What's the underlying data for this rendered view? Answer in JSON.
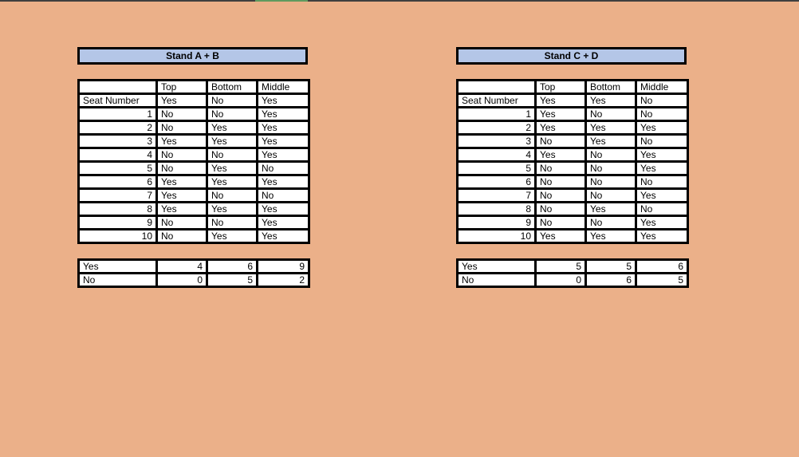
{
  "stands": [
    {
      "title": "Stand A + B",
      "headers": [
        "",
        "Top",
        "Bottom",
        "Middle"
      ],
      "seat_label": "Seat Number",
      "seat_values": [
        "Yes",
        "No",
        "Yes"
      ],
      "rows": [
        {
          "seat": "1",
          "top": "No",
          "bottom": "No",
          "middle": "Yes"
        },
        {
          "seat": "2",
          "top": "No",
          "bottom": "Yes",
          "middle": "Yes"
        },
        {
          "seat": "3",
          "top": "Yes",
          "bottom": "Yes",
          "middle": "Yes"
        },
        {
          "seat": "4",
          "top": "No",
          "bottom": "No",
          "middle": "Yes"
        },
        {
          "seat": "5",
          "top": "No",
          "bottom": "Yes",
          "middle": "No"
        },
        {
          "seat": "6",
          "top": "Yes",
          "bottom": "Yes",
          "middle": "Yes"
        },
        {
          "seat": "7",
          "top": "Yes",
          "bottom": "No",
          "middle": "No"
        },
        {
          "seat": "8",
          "top": "Yes",
          "bottom": "Yes",
          "middle": "Yes"
        },
        {
          "seat": "9",
          "top": "No",
          "bottom": "No",
          "middle": "Yes"
        },
        {
          "seat": "10",
          "top": "No",
          "bottom": "Yes",
          "middle": "Yes"
        }
      ],
      "summary": [
        {
          "label": "Yes",
          "top": "4",
          "bottom": "6",
          "middle": "9"
        },
        {
          "label": "No",
          "top": "0",
          "bottom": "5",
          "middle": "2"
        }
      ]
    },
    {
      "title": "Stand C + D",
      "headers": [
        "",
        "Top",
        "Bottom",
        "Middle"
      ],
      "seat_label": "Seat Number",
      "seat_values": [
        "Yes",
        "Yes",
        "No"
      ],
      "rows": [
        {
          "seat": "1",
          "top": "Yes",
          "bottom": "No",
          "middle": "No"
        },
        {
          "seat": "2",
          "top": "Yes",
          "bottom": "Yes",
          "middle": "Yes"
        },
        {
          "seat": "3",
          "top": "No",
          "bottom": "Yes",
          "middle": "No"
        },
        {
          "seat": "4",
          "top": "Yes",
          "bottom": "No",
          "middle": "Yes"
        },
        {
          "seat": "5",
          "top": "No",
          "bottom": "No",
          "middle": "Yes"
        },
        {
          "seat": "6",
          "top": "No",
          "bottom": "No",
          "middle": "No"
        },
        {
          "seat": "7",
          "top": "No",
          "bottom": "No",
          "middle": "Yes"
        },
        {
          "seat": "8",
          "top": "No",
          "bottom": "Yes",
          "middle": "No"
        },
        {
          "seat": "9",
          "top": "No",
          "bottom": "No",
          "middle": "Yes"
        },
        {
          "seat": "10",
          "top": "Yes",
          "bottom": "Yes",
          "middle": "Yes"
        }
      ],
      "summary": [
        {
          "label": "Yes",
          "top": "5",
          "bottom": "5",
          "middle": "6"
        },
        {
          "label": "No",
          "top": "0",
          "bottom": "6",
          "middle": "5"
        }
      ]
    }
  ],
  "colors": {
    "background": "#ebb089",
    "title_fill": "#b4c6e7",
    "cell_fill": "#ffffff",
    "border": "#000000"
  }
}
